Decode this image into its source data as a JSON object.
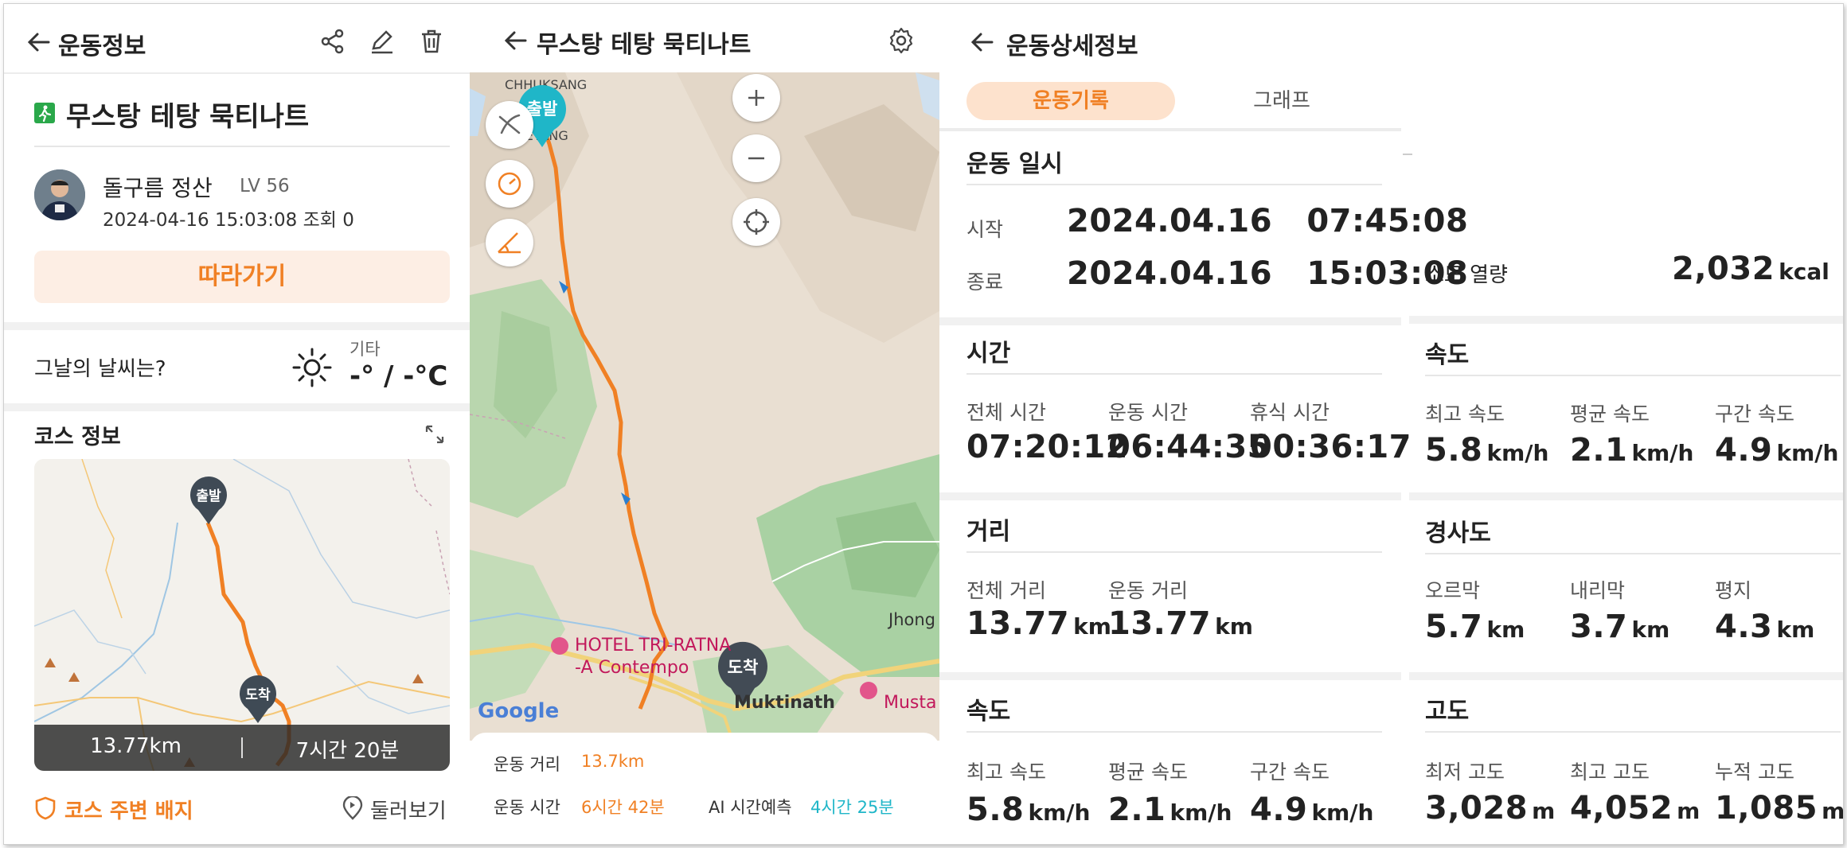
{
  "p1": {
    "header": {
      "title": "운동정보"
    },
    "activity": {
      "title": "무스탕 테탕 묵티나트"
    },
    "user": {
      "name": "돌구름 정산",
      "level": "LV 56",
      "meta": "2024-04-16 15:03:08 조회 0"
    },
    "follow_label": "따라가기",
    "weather": {
      "question": "그날의 날씨는?",
      "condition": "기타",
      "temp": "-° / -°C"
    },
    "course": {
      "title": "코스 정보",
      "start": "출발",
      "end": "도착",
      "distance": "13.77km",
      "duration": "7시간 20분"
    },
    "badge_label": "코스 주변 배지",
    "lookaround_label": "둘러보기"
  },
  "p2": {
    "header": {
      "title": "무스탕 테탕 묵티나트"
    },
    "map": {
      "start": "출발",
      "end": "도착",
      "places": [
        "CHHUKSANG",
        "TETANG",
        "HOTEL TRI-RATNA",
        "-A Contempo",
        "Muktinath",
        "Musta",
        "Jhong"
      ],
      "provider": "Google"
    },
    "stats": {
      "distance_label": "운동 거리",
      "distance_value": "13.7km",
      "time_label": "운동 시간",
      "time_value": "6시간 42분",
      "ai_label": "AI 시간예측",
      "ai_value": "4시간 25분"
    }
  },
  "p3": {
    "header": {
      "title": "운동상세정보"
    },
    "tabs": [
      {
        "label": "운동기록"
      },
      {
        "label": "그래프"
      }
    ],
    "datetime": {
      "title": "운동 일시",
      "start_label": "시작",
      "start_value": "2024.04.16   07:45:08",
      "end_label": "종료",
      "end_value": "2024.04.16   15:03:08"
    },
    "time": {
      "title": "시간",
      "items": [
        {
          "label": "전체 시간",
          "value": "07:20:12"
        },
        {
          "label": "운동 시간",
          "value": "06:44:35"
        },
        {
          "label": "휴식 시간",
          "value": "00:36:17"
        }
      ]
    },
    "distance": {
      "title": "거리",
      "items": [
        {
          "label": "전체 거리",
          "value": "13.77",
          "unit": "km"
        },
        {
          "label": "운동 거리",
          "value": "13.77",
          "unit": "km"
        }
      ]
    },
    "speed": {
      "title": "속도",
      "items": [
        {
          "label": "최고 속도",
          "value": "5.8",
          "unit": "km/h"
        },
        {
          "label": "평균 속도",
          "value": "2.1",
          "unit": "km/h"
        },
        {
          "label": "구간 속도",
          "value": "4.9",
          "unit": "km/h"
        }
      ]
    },
    "calories": {
      "label": "소모 열량",
      "value": "2,032",
      "unit": "kcal"
    },
    "speed2": {
      "title": "속도",
      "items": [
        {
          "label": "최고 속도",
          "value": "5.8",
          "unit": "km/h"
        },
        {
          "label": "평균 속도",
          "value": "2.1",
          "unit": "km/h"
        },
        {
          "label": "구간 속도",
          "value": "4.9",
          "unit": "km/h"
        }
      ]
    },
    "slope": {
      "title": "경사도",
      "items": [
        {
          "label": "오르막",
          "value": "5.7",
          "unit": "km"
        },
        {
          "label": "내리막",
          "value": "3.7",
          "unit": "km"
        },
        {
          "label": "평지",
          "value": "4.3",
          "unit": "km"
        }
      ]
    },
    "altitude": {
      "title": "고도",
      "items": [
        {
          "label": "최저 고도",
          "value": "3,028",
          "unit": "m"
        },
        {
          "label": "최고 고도",
          "value": "4,052",
          "unit": "m"
        },
        {
          "label": "누적 고도",
          "value": "1,085",
          "unit": "m"
        }
      ]
    }
  },
  "colors": {
    "accent": "#f08024",
    "teal": "#1fb6c8",
    "pin": "#3f4a55"
  }
}
